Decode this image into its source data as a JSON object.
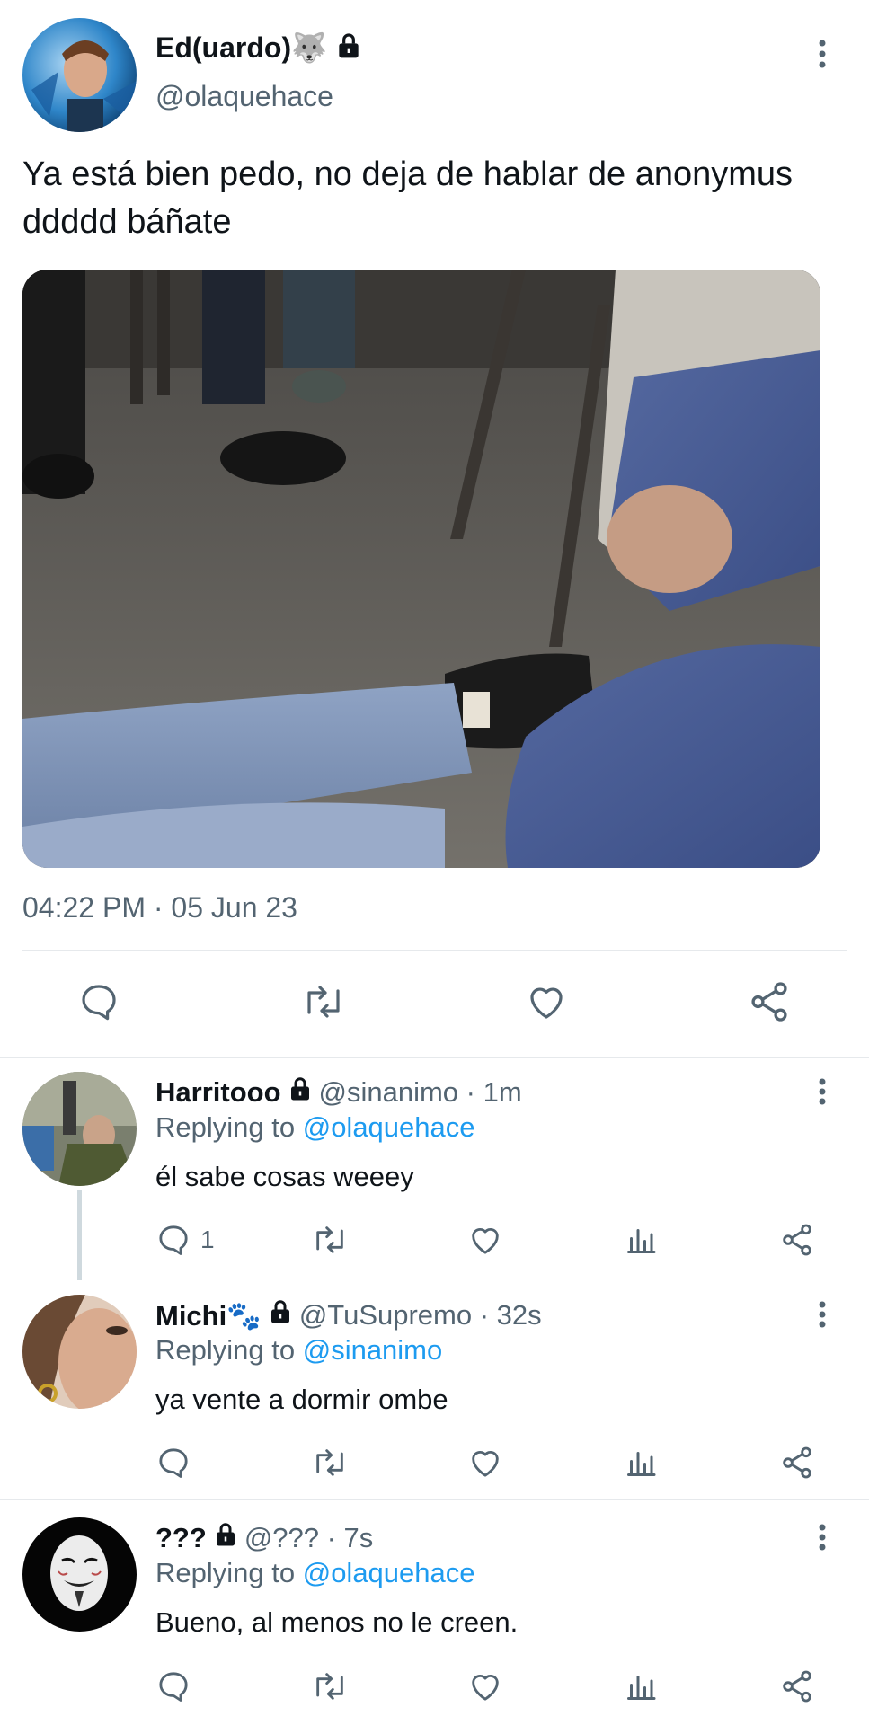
{
  "main_tweet": {
    "display_name": "Ed(uardo)🐺",
    "handle": "@olaquehace",
    "text": "Ya está bien pedo, no deja de hablar de anonymus ddddd báñate",
    "timestamp": "04:22 PM · 05 Jun 23",
    "actions": [
      "reply-icon",
      "retweet-icon",
      "like-icon",
      "share-icon"
    ]
  },
  "replies": [
    {
      "name": "Harritooo",
      "handle_time": "@sinanimo · 1m",
      "replying_prefix": "Replying to",
      "replying_to": "@olaquehace",
      "text": "él sabe cosas weeey",
      "reply_count": "1"
    },
    {
      "name": "Michi🐾",
      "handle_time": "@TuSupremo · 32s",
      "replying_prefix": "Replying to",
      "replying_to": "@sinanimo",
      "text": "ya vente a dormir ombe",
      "reply_count": ""
    },
    {
      "name": "???",
      "handle_time": "@??? · 7s",
      "replying_prefix": "Replying to",
      "replying_to": "@olaquehace",
      "text": "Bueno, al menos no le creen.",
      "reply_count": ""
    }
  ],
  "colors": {
    "text": "#0f1419",
    "secondary": "#536471",
    "link": "#1d9bf0",
    "divider": "#e6e9ec"
  }
}
